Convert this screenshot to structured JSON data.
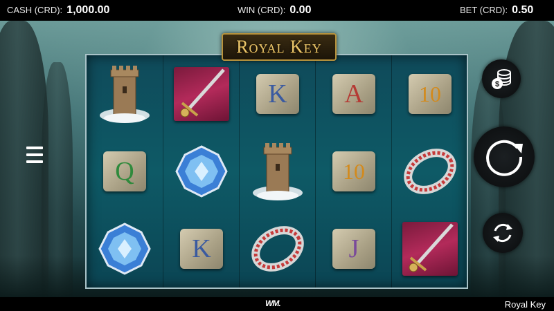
{
  "topbar": {
    "cash_label": "CASH (CRD):",
    "cash_value": "1,000.00",
    "win_label": "WIN (CRD):",
    "win_value": "0.00",
    "bet_label": "BET (CRD):",
    "bet_value": "0.50"
  },
  "game": {
    "logo": "Royal Key"
  },
  "reels": [
    [
      "tower",
      "sword",
      "diamond"
    ],
    [
      "sword",
      "diamond",
      "K"
    ],
    [
      "K",
      "tower",
      "ring"
    ],
    [
      "A",
      "10",
      "J"
    ],
    [
      "10",
      "ring",
      "sword"
    ]
  ],
  "cards": {
    "r1c0": "K",
    "r1c1": "K",
    "r2c0": "A",
    "r2c1": "Q",
    "r3c0": "10",
    "r3c1": "10",
    "r3c2": "J"
  },
  "bottombar": {
    "provider": "WM.",
    "game_name": "Royal Key"
  },
  "icons": {
    "menu": "hamburger-icon",
    "coins": "coin-stack-icon",
    "spin": "spin-arrow-icon",
    "autoplay": "autoplay-icon"
  }
}
